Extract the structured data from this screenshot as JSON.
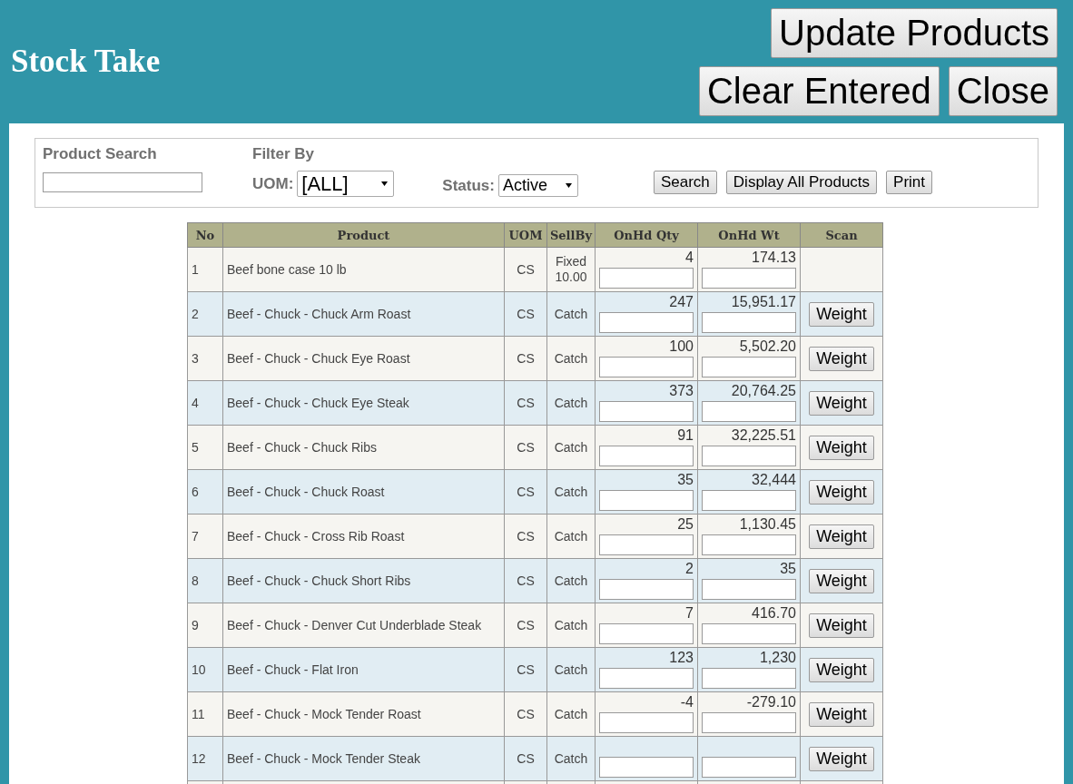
{
  "header": {
    "title": "Stock Take",
    "buttons": [
      "Update Products",
      "Clear Entered",
      "Close"
    ]
  },
  "filters": {
    "search_label": "Product Search",
    "filter_label": "Filter By",
    "uom_label": "UOM:",
    "uom_value": "[ALL]",
    "status_label": "Status:",
    "status_value": "Active",
    "buttons": [
      "Search",
      "Display All Products",
      "Print"
    ]
  },
  "table": {
    "columns": [
      "No",
      "Product",
      "UOM",
      "SellBy",
      "OnHd Qty",
      "OnHd Wt",
      "Scan"
    ],
    "rows": [
      {
        "no": "1",
        "product": "Beef bone case 10 lb",
        "uom": "CS",
        "sellby": "Fixed 10.00",
        "qty": "4",
        "wt": "174.13"
      },
      {
        "no": "2",
        "product": "Beef - Chuck - Chuck Arm Roast",
        "uom": "CS",
        "sellby": "Catch",
        "qty": "247",
        "wt": "15,951.17",
        "scan": "Weight"
      },
      {
        "no": "3",
        "product": "Beef - Chuck - Chuck Eye Roast",
        "uom": "CS",
        "sellby": "Catch",
        "qty": "100",
        "wt": "5,502.20",
        "scan": "Weight"
      },
      {
        "no": "4",
        "product": "Beef - Chuck - Chuck Eye Steak",
        "uom": "CS",
        "sellby": "Catch",
        "qty": "373",
        "wt": "20,764.25",
        "scan": "Weight"
      },
      {
        "no": "5",
        "product": "Beef - Chuck - Chuck Ribs",
        "uom": "CS",
        "sellby": "Catch",
        "qty": "91",
        "wt": "32,225.51",
        "scan": "Weight"
      },
      {
        "no": "6",
        "product": "Beef - Chuck - Chuck Roast",
        "uom": "CS",
        "sellby": "Catch",
        "qty": "35",
        "wt": "32,444",
        "scan": "Weight"
      },
      {
        "no": "7",
        "product": "Beef - Chuck - Cross Rib Roast",
        "uom": "CS",
        "sellby": "Catch",
        "qty": "25",
        "wt": "1,130.45",
        "scan": "Weight"
      },
      {
        "no": "8",
        "product": "Beef - Chuck - Chuck Short Ribs",
        "uom": "CS",
        "sellby": "Catch",
        "qty": "2",
        "wt": "35",
        "scan": "Weight"
      },
      {
        "no": "9",
        "product": "Beef - Chuck - Denver Cut Underblade Steak",
        "uom": "CS",
        "sellby": "Catch",
        "qty": "7",
        "wt": "416.70",
        "scan": "Weight"
      },
      {
        "no": "10",
        "product": "Beef - Chuck - Flat Iron",
        "uom": "CS",
        "sellby": "Catch",
        "qty": "123",
        "wt": "1,230",
        "scan": "Weight"
      },
      {
        "no": "11",
        "product": "Beef - Chuck - Mock Tender Roast",
        "uom": "CS",
        "sellby": "Catch",
        "qty": "-4",
        "wt": "-279.10",
        "scan": "Weight"
      },
      {
        "no": "12",
        "product": "Beef - Chuck - Mock Tender Steak",
        "uom": "CS",
        "sellby": "Catch",
        "scan": "Weight"
      }
    ]
  }
}
